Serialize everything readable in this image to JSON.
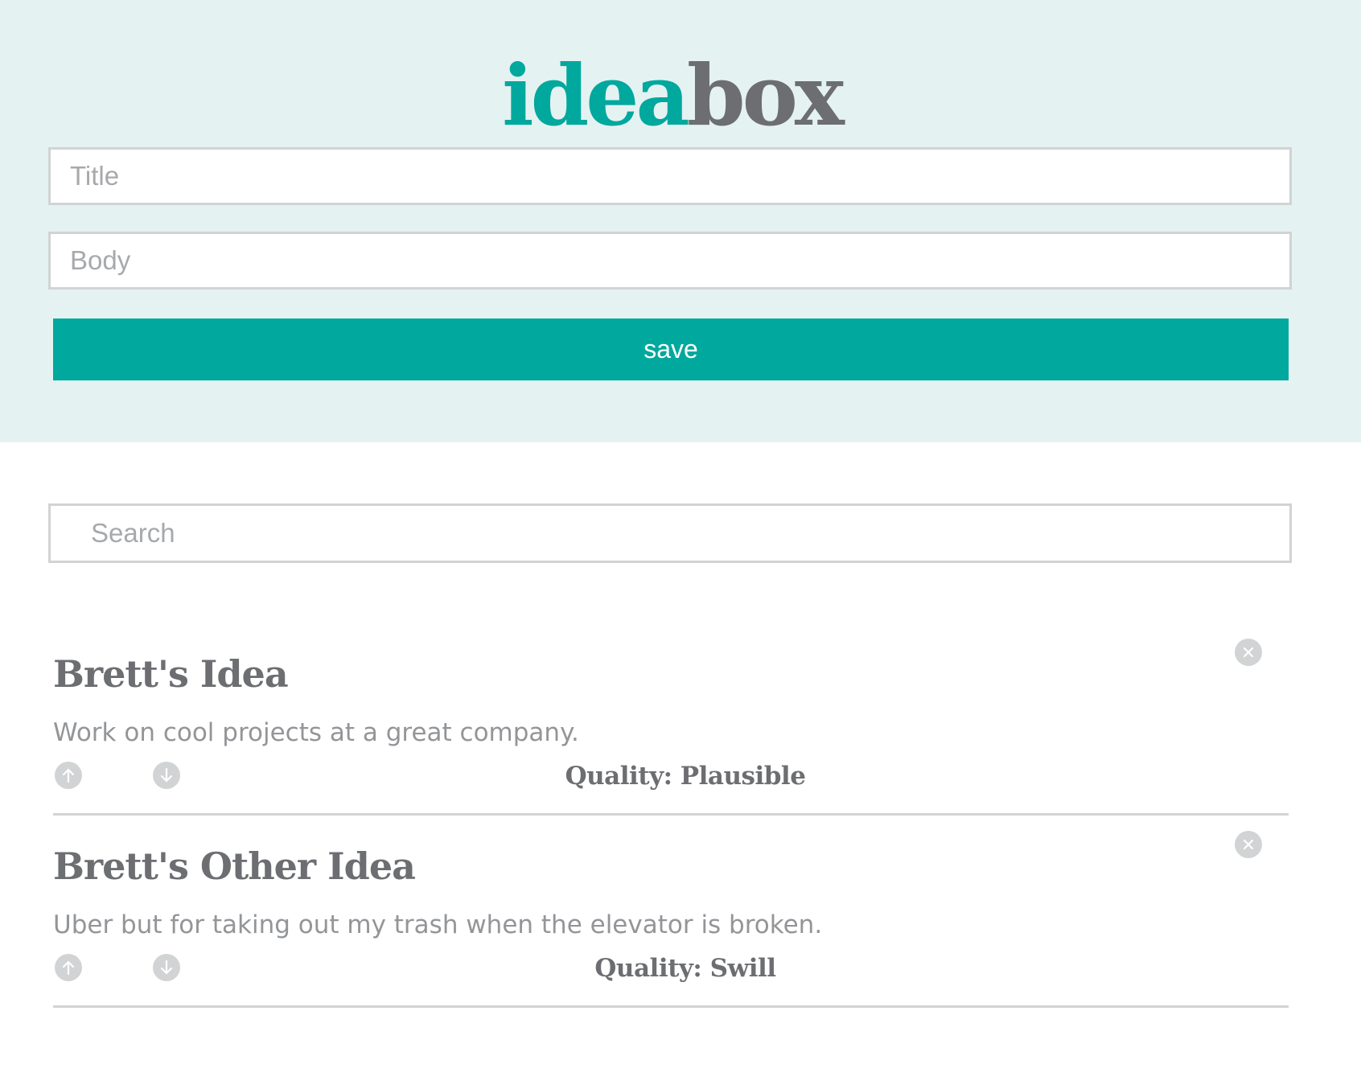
{
  "header": {
    "logo_part1": "idea",
    "logo_part2": "box"
  },
  "form": {
    "title_placeholder": "Title",
    "body_placeholder": "Body",
    "save_label": "save"
  },
  "search": {
    "placeholder": "Search"
  },
  "ideas": [
    {
      "title": "Brett's Idea",
      "body": "Work on cool projects at a great company.",
      "quality": "Quality: Plausible"
    },
    {
      "title": "Brett's Other Idea",
      "body": "Uber but for taking out my trash when the elevator is broken.",
      "quality": "Quality: Swill"
    }
  ],
  "icons": {
    "upvote": "arrow-up-icon",
    "downvote": "arrow-down-icon",
    "delete": "close-icon"
  },
  "colors": {
    "accent": "#00a89d",
    "header_bg": "#e5f2f2",
    "text_dark": "#6d6e71",
    "text_light": "#939598",
    "border": "#d1d3d4"
  }
}
